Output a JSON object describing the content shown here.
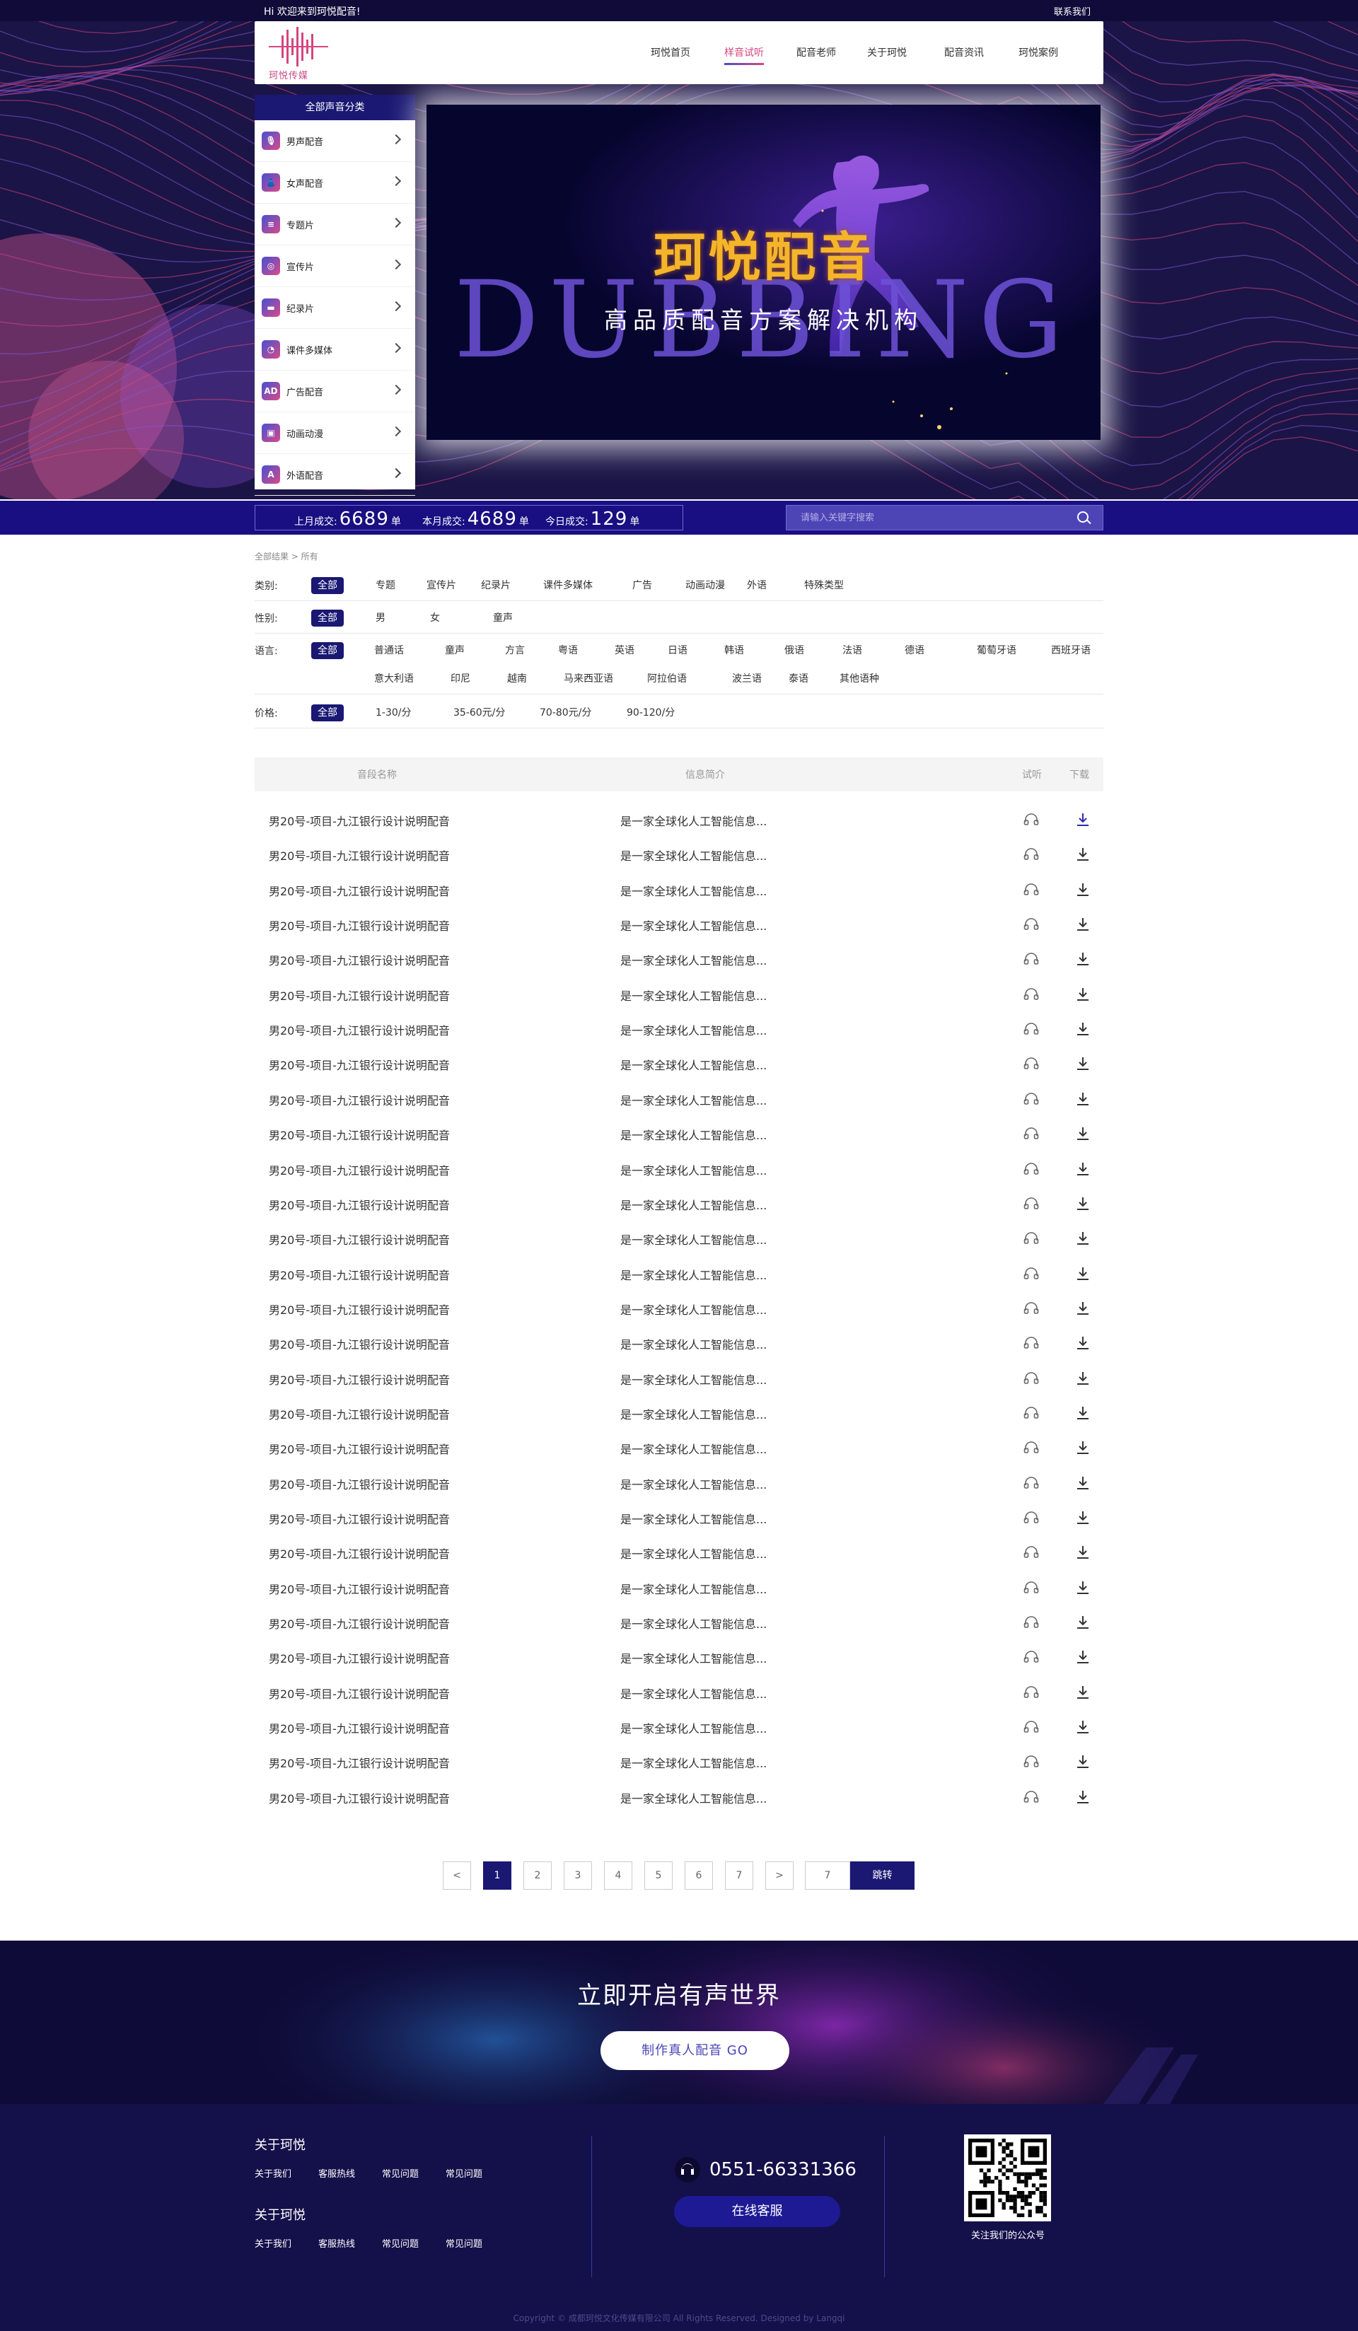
{
  "topbar": {
    "welcome": "Hi 欢迎来到珂悦配音!",
    "contact": "联系我们"
  },
  "logo": {
    "text": "珂悦传媒"
  },
  "nav": [
    "珂悦首页",
    "样音试听",
    "配音老师",
    "关于珂悦",
    "配音资讯",
    "珂悦案例"
  ],
  "nav_active": "样音试听",
  "sidebar": {
    "title": "全部声音分类",
    "items": [
      {
        "label": "男声配音",
        "icon": "microphone-icon"
      },
      {
        "label": "女声配音",
        "icon": "dress-icon"
      },
      {
        "label": "专题片",
        "icon": "document-icon"
      },
      {
        "label": "宣传片",
        "icon": "film-reel-icon"
      },
      {
        "label": "纪录片",
        "icon": "clapperboard-icon"
      },
      {
        "label": "课件多媒体",
        "icon": "pie-icon"
      },
      {
        "label": "广告配音",
        "icon": "ad-icon"
      },
      {
        "label": "动画动漫",
        "icon": "camera-icon"
      },
      {
        "label": "外语配音",
        "icon": "letter-a-icon"
      }
    ]
  },
  "banner": {
    "title": "珂悦配音",
    "bg_text": "DUBBING",
    "subtitle": "高品质配音方案解决机构",
    "slides": 3,
    "active_slide": 1
  },
  "stats": {
    "last_month_label": "上月成交:",
    "last_month_value": "6689",
    "unit": "单",
    "this_month_label": "本月成交:",
    "this_month_value": "4689",
    "today_label": "今日成交:",
    "today_value": "129"
  },
  "search": {
    "placeholder": "请输入关键字搜索"
  },
  "breadcrumb": "全部结果 > 所有",
  "filters": {
    "category": {
      "label": "类别:",
      "options": [
        "全部",
        "专题",
        "宣传片",
        "纪录片",
        "课件多媒体",
        "广告",
        "动画动漫",
        "外语",
        "特殊类型"
      ]
    },
    "gender": {
      "label": "性别:",
      "options": [
        "全部",
        "男",
        "女",
        "童声"
      ]
    },
    "language": {
      "label": "语言:",
      "options": [
        "全部",
        "普通话",
        "童声",
        "方言",
        "粤语",
        "英语",
        "日语",
        "韩语",
        "俄语",
        "法语",
        "德语",
        "葡萄牙语",
        "西班牙语",
        "意大利语",
        "印尼",
        "越南",
        "马来西亚语",
        "阿拉伯语",
        "波兰语",
        "泰语",
        "其他语种"
      ]
    },
    "price": {
      "label": "价格:",
      "options": [
        "全部",
        "1-30/分",
        "35-60元/分",
        "70-80元/分",
        "90-120/分"
      ]
    }
  },
  "table": {
    "headers": {
      "name": "音段名称",
      "info": "信息简介",
      "listen": "试听",
      "download": "下载"
    },
    "rows": [
      {
        "name": "男20号-项目-九江银行设计说明配音",
        "info": "是一家全球化人工智能信息..."
      },
      {
        "name": "男20号-项目-九江银行设计说明配音",
        "info": "是一家全球化人工智能信息..."
      },
      {
        "name": "男20号-项目-九江银行设计说明配音",
        "info": "是一家全球化人工智能信息..."
      },
      {
        "name": "男20号-项目-九江银行设计说明配音",
        "info": "是一家全球化人工智能信息..."
      },
      {
        "name": "男20号-项目-九江银行设计说明配音",
        "info": "是一家全球化人工智能信息..."
      },
      {
        "name": "男20号-项目-九江银行设计说明配音",
        "info": "是一家全球化人工智能信息..."
      },
      {
        "name": "男20号-项目-九江银行设计说明配音",
        "info": "是一家全球化人工智能信息..."
      },
      {
        "name": "男20号-项目-九江银行设计说明配音",
        "info": "是一家全球化人工智能信息..."
      },
      {
        "name": "男20号-项目-九江银行设计说明配音",
        "info": "是一家全球化人工智能信息..."
      },
      {
        "name": "男20号-项目-九江银行设计说明配音",
        "info": "是一家全球化人工智能信息..."
      },
      {
        "name": "男20号-项目-九江银行设计说明配音",
        "info": "是一家全球化人工智能信息..."
      },
      {
        "name": "男20号-项目-九江银行设计说明配音",
        "info": "是一家全球化人工智能信息..."
      },
      {
        "name": "男20号-项目-九江银行设计说明配音",
        "info": "是一家全球化人工智能信息..."
      },
      {
        "name": "男20号-项目-九江银行设计说明配音",
        "info": "是一家全球化人工智能信息..."
      },
      {
        "name": "男20号-项目-九江银行设计说明配音",
        "info": "是一家全球化人工智能信息..."
      },
      {
        "name": "男20号-项目-九江银行设计说明配音",
        "info": "是一家全球化人工智能信息..."
      },
      {
        "name": "男20号-项目-九江银行设计说明配音",
        "info": "是一家全球化人工智能信息..."
      },
      {
        "name": "男20号-项目-九江银行设计说明配音",
        "info": "是一家全球化人工智能信息..."
      },
      {
        "name": "男20号-项目-九江银行设计说明配音",
        "info": "是一家全球化人工智能信息..."
      },
      {
        "name": "男20号-项目-九江银行设计说明配音",
        "info": "是一家全球化人工智能信息..."
      },
      {
        "name": "男20号-项目-九江银行设计说明配音",
        "info": "是一家全球化人工智能信息..."
      },
      {
        "name": "男20号-项目-九江银行设计说明配音",
        "info": "是一家全球化人工智能信息..."
      },
      {
        "name": "男20号-项目-九江银行设计说明配音",
        "info": "是一家全球化人工智能信息..."
      },
      {
        "name": "男20号-项目-九江银行设计说明配音",
        "info": "是一家全球化人工智能信息..."
      },
      {
        "name": "男20号-项目-九江银行设计说明配音",
        "info": "是一家全球化人工智能信息..."
      },
      {
        "name": "男20号-项目-九江银行设计说明配音",
        "info": "是一家全球化人工智能信息..."
      },
      {
        "name": "男20号-项目-九江银行设计说明配音",
        "info": "是一家全球化人工智能信息..."
      },
      {
        "name": "男20号-项目-九江银行设计说明配音",
        "info": "是一家全球化人工智能信息..."
      },
      {
        "name": "男20号-项目-九江银行设计说明配音",
        "info": "是一家全球化人工智能信息..."
      }
    ]
  },
  "pagination": {
    "prev": "<",
    "pages": [
      "1",
      "2",
      "3",
      "4",
      "5",
      "6",
      "7"
    ],
    "current": "1",
    "next": ">",
    "jump_value": "7",
    "jump_label": "跳转"
  },
  "cta": {
    "title": "立即开启有声世界",
    "button": "制作真人配音 GO"
  },
  "footer": {
    "col1_title": "关于珂悦",
    "col1_links": [
      "关于我们",
      "客服热线",
      "常见问题",
      "常见问题"
    ],
    "col2_title": "关于珂悦",
    "col2_links": [
      "关于我们",
      "客服热线",
      "常见问题",
      "常见问题"
    ],
    "phone": "0551-66331366",
    "service_button": "在线客服",
    "qr_caption": "关注我们的公众号",
    "copyright": "Copyright © 成都珂悦文化传媒有限公司 All Rights Reserved. Designed by Langqi"
  },
  "colors": {
    "primary": "#1a1873",
    "accent": "#d5457e",
    "gold": "#f5b52a",
    "footer_bg": "#14104a"
  }
}
